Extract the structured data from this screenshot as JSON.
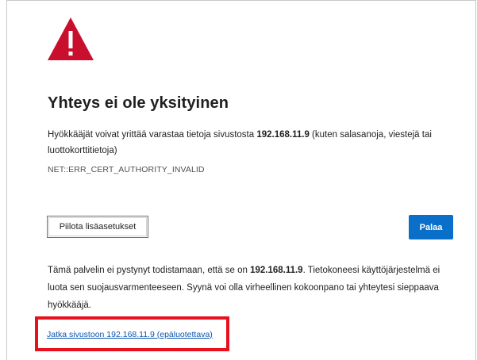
{
  "page": {
    "title": "Yhteys ei ole yksityinen",
    "description_prefix": "Hyökkääjät voivat yrittää varastaa tietoja sivustosta ",
    "description_host": "192.168.11.9",
    "description_suffix": " (kuten salasanoja, viestejä tai luottokorttitietoja)",
    "error_code": "NET::ERR_CERT_AUTHORITY_INVALID"
  },
  "buttons": {
    "advanced_label": "Piilota lisäasetukset",
    "back_label": "Palaa"
  },
  "details": {
    "text_prefix": "Tämä palvelin ei pystynyt todistamaan, että se on ",
    "host": "192.168.11.9",
    "text_suffix": ". Tietokoneesi käyttöjärjestelmä ei luota sen suojausvarmenteeseen. Syynä voi olla virheellinen kokoonpano tai yhteytesi sieppaava hyökkääjä.",
    "proceed_link": "Jatka sivustoon 192.168.11.9 (epäluotettava)"
  },
  "icons": {
    "warning": "warning-triangle-icon"
  },
  "colors": {
    "warning_red": "#c8102e",
    "primary_blue": "#0a6fc8",
    "link_blue": "#0a55b0",
    "highlight_red": "#e8101c"
  }
}
